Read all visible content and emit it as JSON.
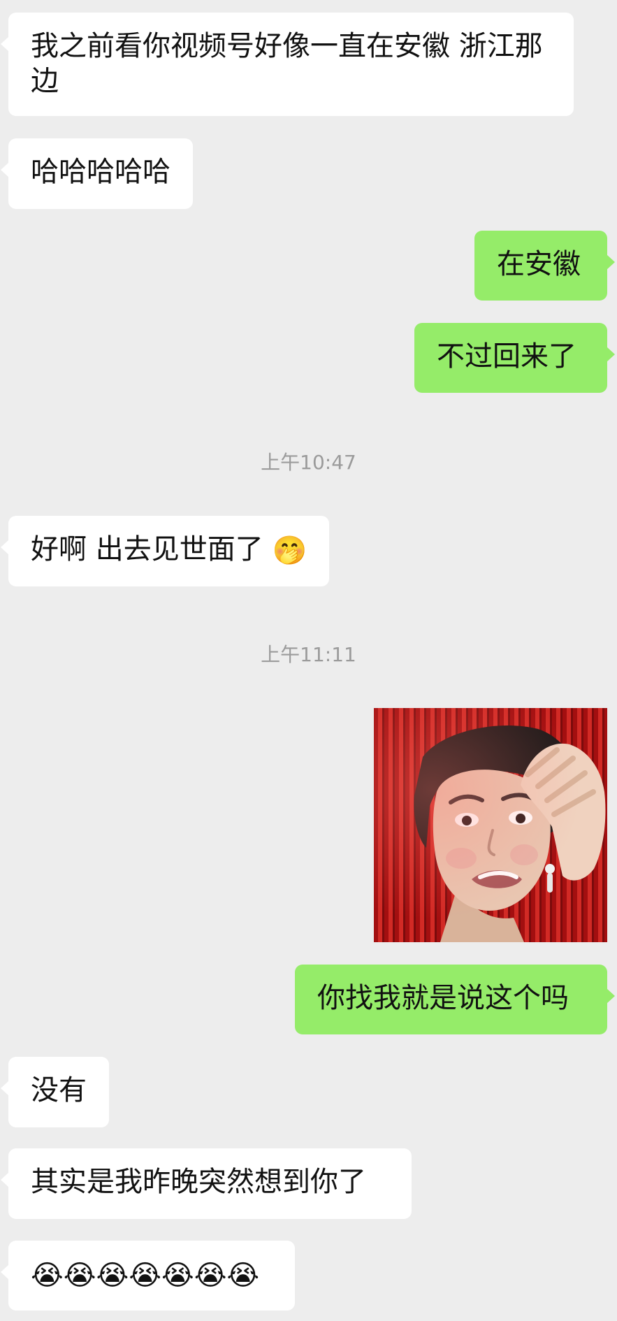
{
  "messages": [
    {
      "side": "left",
      "text": "我之前看你视频号好像一直在安徽 浙江那边"
    },
    {
      "side": "left",
      "text": "哈哈哈哈哈"
    },
    {
      "side": "right",
      "text": "在安徽"
    },
    {
      "side": "right",
      "text": "不过回来了"
    },
    {
      "type": "time",
      "text": "上午10:47"
    },
    {
      "side": "left",
      "text": "好啊 出去见世面了",
      "emoji": "🤭"
    },
    {
      "type": "time",
      "text": "上午11:11"
    },
    {
      "side": "right",
      "type": "image",
      "image_icon": "meme-image"
    },
    {
      "side": "right",
      "text": "你找我就是说这个吗"
    },
    {
      "side": "left",
      "text": "没有"
    },
    {
      "side": "left",
      "text": "其实是我昨晚突然想到你了"
    },
    {
      "side": "left",
      "emoji": "😭😭😭😭😭😭😭"
    }
  ],
  "colors": {
    "background": "#ededed",
    "left_bubble": "#ffffff",
    "right_bubble": "#95ec69",
    "timestamp": "#9b9b9b"
  }
}
